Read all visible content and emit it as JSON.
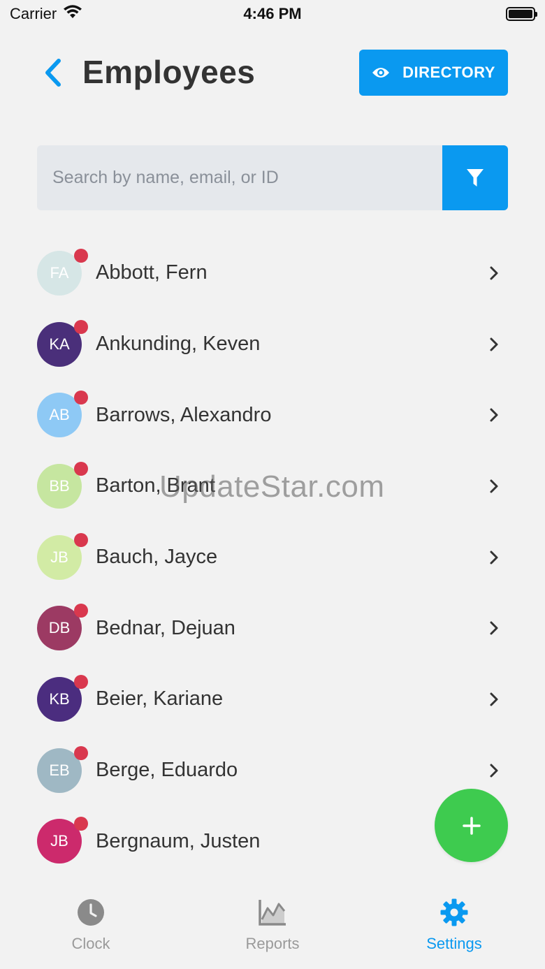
{
  "status_bar": {
    "carrier": "Carrier",
    "time": "4:46 PM"
  },
  "header": {
    "title": "Employees",
    "directory_label": "DIRECTORY"
  },
  "search": {
    "placeholder": "Search by name, email, or ID",
    "value": ""
  },
  "employees": [
    {
      "initials": "FA",
      "name": "Abbott, Fern",
      "avatar_color": "#d6e6e6",
      "initials_color": "#ffffff"
    },
    {
      "initials": "KA",
      "name": "Ankunding, Keven",
      "avatar_color": "#4a2f7a",
      "initials_color": "#ffffff"
    },
    {
      "initials": "AB",
      "name": "Barrows, Alexandro",
      "avatar_color": "#8ec9f5",
      "initials_color": "#ffffff"
    },
    {
      "initials": "BB",
      "name": "Barton, Brant",
      "avatar_color": "#c6e6a0",
      "initials_color": "#ffffff"
    },
    {
      "initials": "JB",
      "name": "Bauch, Jayce",
      "avatar_color": "#d2eba5",
      "initials_color": "#ffffff"
    },
    {
      "initials": "DB",
      "name": "Bednar, Dejuan",
      "avatar_color": "#9c3a63",
      "initials_color": "#ffffff"
    },
    {
      "initials": "KB",
      "name": "Beier, Kariane",
      "avatar_color": "#4b2d7f",
      "initials_color": "#ffffff"
    },
    {
      "initials": "EB",
      "name": "Berge, Eduardo",
      "avatar_color": "#9fb8c4",
      "initials_color": "#ffffff"
    },
    {
      "initials": "JB",
      "name": "Bergnaum, Justen",
      "avatar_color": "#cc2a6c",
      "initials_color": "#ffffff"
    }
  ],
  "watermark": "UpdateStar.com",
  "tabs": [
    {
      "label": "Clock",
      "icon": "clock-icon",
      "active": false
    },
    {
      "label": "Reports",
      "icon": "chart-icon",
      "active": false
    },
    {
      "label": "Settings",
      "icon": "gear-icon",
      "active": true
    }
  ],
  "colors": {
    "accent": "#0a99f0",
    "fab": "#3ecb4f",
    "status_dot": "#d9384e",
    "background": "#f2f2f2"
  }
}
